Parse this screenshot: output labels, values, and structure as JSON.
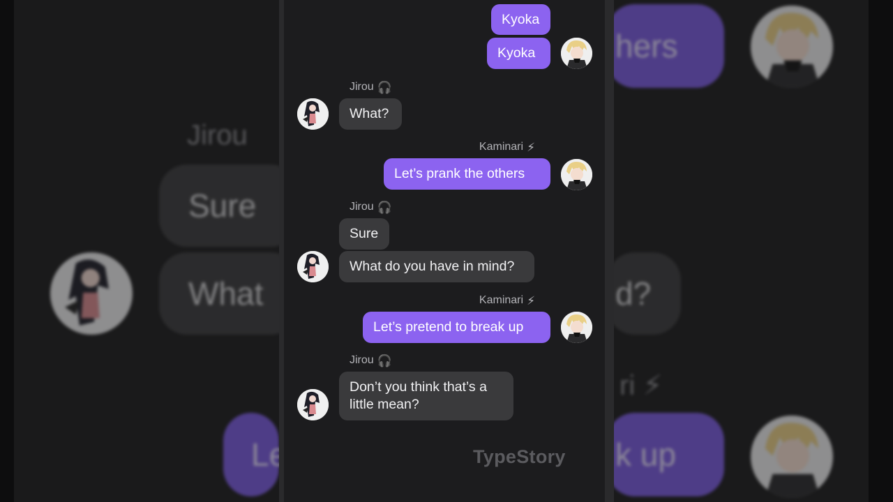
{
  "app": {
    "watermark": "TypeStory"
  },
  "characters": {
    "jirou": {
      "name": "Jirou",
      "emoji": "🎧",
      "avatar_icon": "jirou-avatar-icon"
    },
    "kaminari": {
      "name": "Kaminari",
      "emoji": "⚡",
      "avatar_icon": "kaminari-avatar-icon"
    }
  },
  "messages": [
    {
      "from": "kaminari",
      "text": "Kyoka"
    },
    {
      "from": "kaminari",
      "text": "Kyoka"
    },
    {
      "from": "jirou",
      "text": "What?"
    },
    {
      "from": "kaminari",
      "text": "Let’s prank the others"
    },
    {
      "from": "jirou",
      "text": "Sure"
    },
    {
      "from": "jirou",
      "text": "What do you have in mind?"
    },
    {
      "from": "kaminari",
      "text": "Let’s pretend to break up"
    },
    {
      "from": "jirou",
      "text": "Don’t you think that’s a little mean?"
    }
  ],
  "background_fragments": {
    "name_left": "Jirou",
    "bubble_left_1": "Sure",
    "bubble_left_2": "What",
    "bubble_right_1": "hers",
    "bubble_right_2": "d?",
    "name_right": "ri ⚡",
    "bubble_bottom_left": "Le",
    "bubble_bottom_right": "k up"
  },
  "colors": {
    "sent_bubble": "#8c63f0",
    "received_bubble": "#3a3a3c",
    "chat_background": "#1c1c1e"
  }
}
